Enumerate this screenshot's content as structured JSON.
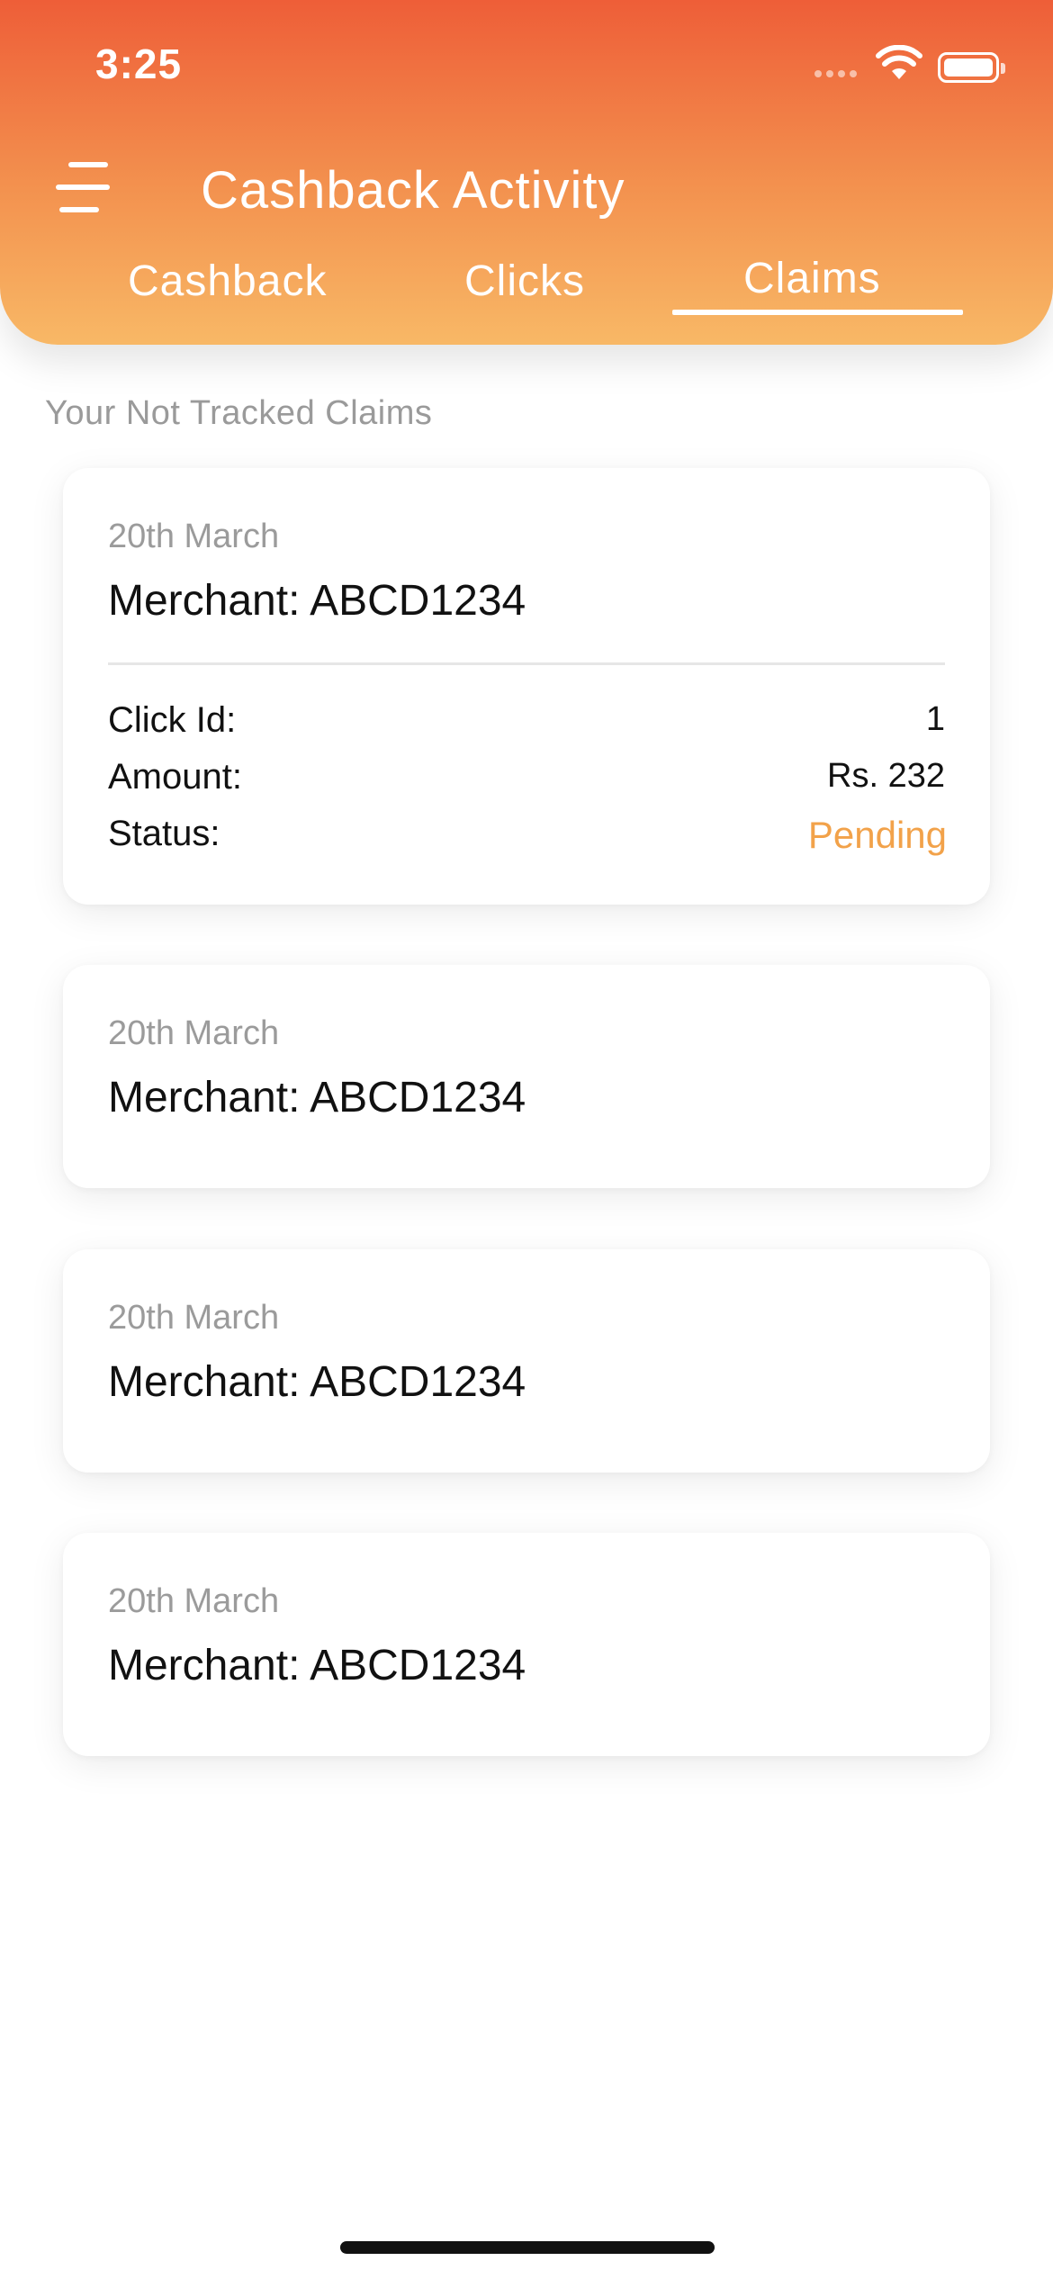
{
  "status_bar": {
    "time": "3:25"
  },
  "header": {
    "title": "Cashback Activity",
    "tabs": [
      {
        "label": "Cashback",
        "active": false
      },
      {
        "label": "Clicks",
        "active": false
      },
      {
        "label": "Claims",
        "active": true
      }
    ]
  },
  "section_label": "Your Not Tracked Claims",
  "claims": [
    {
      "date": "20th March",
      "merchant": "Merchant: ABCD1234",
      "details": {
        "click_id_label": "Click Id:",
        "click_id_value": "1",
        "amount_label": "Amount:",
        "amount_value": "Rs. 232",
        "status_label": "Status:",
        "status_value": "Pending"
      }
    },
    {
      "date": "20th March",
      "merchant": "Merchant: ABCD1234"
    },
    {
      "date": "20th March",
      "merchant": "Merchant: ABCD1234"
    },
    {
      "date": "20th March",
      "merchant": "Merchant: ABCD1234"
    }
  ],
  "colors": {
    "header_gradient_top": "#EE5E38",
    "header_gradient_bottom": "#F8B866",
    "status_pending": "#F2A24A"
  },
  "icons": {
    "menu": "menu-icon",
    "wifi": "wifi-icon",
    "battery": "battery-icon"
  }
}
